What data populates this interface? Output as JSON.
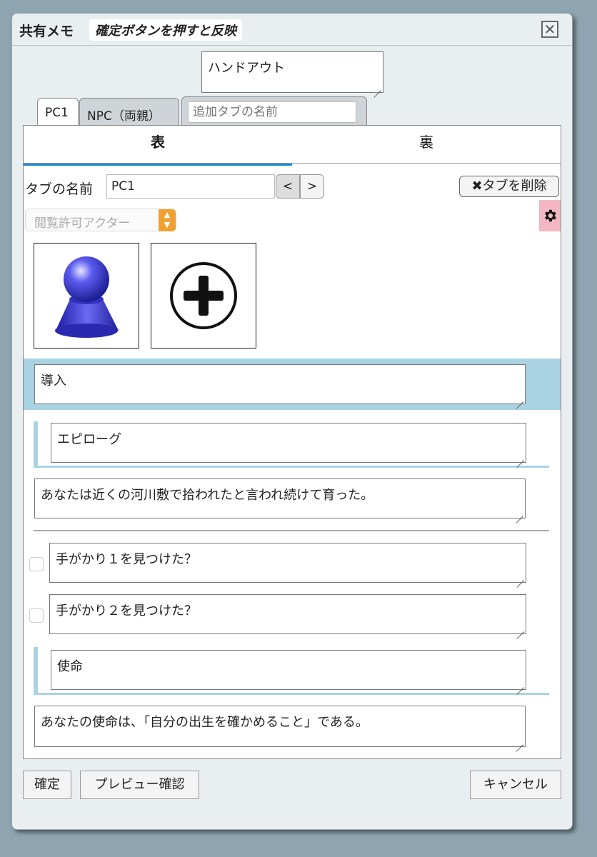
{
  "window": {
    "title": "共有メモ",
    "subtitle": "確定ボタンを押すと反映",
    "close_icon": "close-icon"
  },
  "memo_title": {
    "value": "ハンドアウト"
  },
  "tabs": [
    {
      "label": "PC1",
      "active": true
    },
    {
      "label": "NPC（両親）",
      "active": false
    }
  ],
  "add_tab": {
    "placeholder": "追加タブの名前"
  },
  "sides": {
    "front": "表",
    "back": "裏"
  },
  "tab_name": {
    "label": "タブの名前",
    "value": "PC1",
    "prev": "<",
    "next": ">"
  },
  "delete_tab": {
    "label": "✖タブを削除"
  },
  "actor_select": {
    "value": "閲覧許可アクター"
  },
  "settings_icon": "gear-icon",
  "icons": [
    "avatar-icon",
    "add-circle-icon"
  ],
  "blocks": [
    {
      "type": "heading",
      "text": "導入"
    },
    {
      "type": "subheading",
      "text": "エピローグ"
    },
    {
      "type": "text",
      "text": "あなたは近くの河川敷で拾われたと言われ続けて育った。"
    },
    {
      "type": "divider"
    },
    {
      "type": "check",
      "checked": false,
      "text": "手がかり１を見つけた？"
    },
    {
      "type": "check",
      "checked": false,
      "text": "手がかり２を見つけた？"
    },
    {
      "type": "subheading",
      "text": "使命"
    },
    {
      "type": "text",
      "text": "あなたの使命は、「自分の出生を確かめること」である。"
    }
  ],
  "footer": {
    "confirm": "確定",
    "preview": "プレビュー確認",
    "cancel": "キャンセル"
  },
  "colors": {
    "accent": "#1a8ad4",
    "highlight": "#a9d3e2",
    "settings_bg": "#f4b6c2",
    "select_arrow": "#f0a030"
  }
}
